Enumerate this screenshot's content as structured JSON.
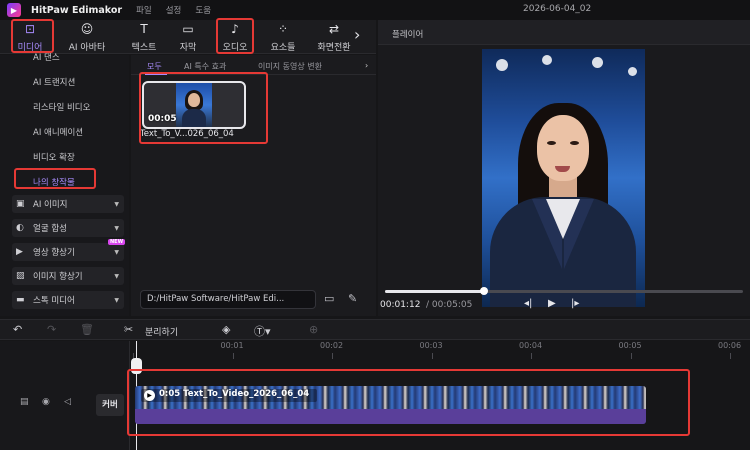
{
  "app": {
    "name": "HitPaw Edimakor",
    "menu": [
      "파일",
      "설정",
      "도움"
    ],
    "doc_title": "2026-06-04_02"
  },
  "toolbar": {
    "items": [
      {
        "label": "미디어",
        "icon": "media-icon",
        "active": true
      },
      {
        "label": "AI 아바타",
        "icon": "avatar-icon",
        "active": false
      },
      {
        "label": "텍스트",
        "icon": "text-icon",
        "active": false
      },
      {
        "label": "자막",
        "icon": "subtitle-icon",
        "active": false
      },
      {
        "label": "오디오",
        "icon": "music-note-icon",
        "active": false
      },
      {
        "label": "요소들",
        "icon": "elements-icon",
        "active": false
      },
      {
        "label": "화면전환",
        "icon": "transition-icon",
        "active": false
      }
    ]
  },
  "sidebar": {
    "links": [
      "AI 댄스",
      "AI 트랜지션",
      "리스타일 비디오",
      "AI 애니메이션",
      "비디오 확장",
      "나의 창작물"
    ],
    "groups": [
      {
        "label": "AI 이미지",
        "icon": "ai-image-icon"
      },
      {
        "label": "얼굴 합성",
        "icon": "face-swap-icon"
      },
      {
        "label": "영상 향상기",
        "icon": "video-enhance-icon"
      },
      {
        "label": "이미지 향상기",
        "icon": "image-enhance-icon"
      },
      {
        "label": "스톡 미디어",
        "icon": "stock-media-icon"
      }
    ],
    "new_badge": "NEW"
  },
  "media": {
    "tabs": [
      "모두",
      "AI 특수 효과",
      "이미지 동영상 변환"
    ],
    "item": {
      "duration": "00:05",
      "name": "Text_To_V...026_06_04"
    },
    "path": "D:/HitPaw Software/HitPaw Edi..."
  },
  "player": {
    "title": "플레이어",
    "current_time": "00:01:12",
    "total_time": "/ 00:05:05",
    "progress": 0.277
  },
  "timeline": {
    "split_label": "분리하기",
    "ruler": [
      "00:00",
      "00:01",
      "00:02",
      "00:03",
      "00:04",
      "00:05",
      "00:06"
    ],
    "cover_label": "커버",
    "clip_label": "0:05 Text_To_Video_2026_06_04"
  },
  "colors": {
    "accent": "#a78bfa",
    "highlight": "#e53935",
    "audio_track": "#5a3f9a"
  }
}
